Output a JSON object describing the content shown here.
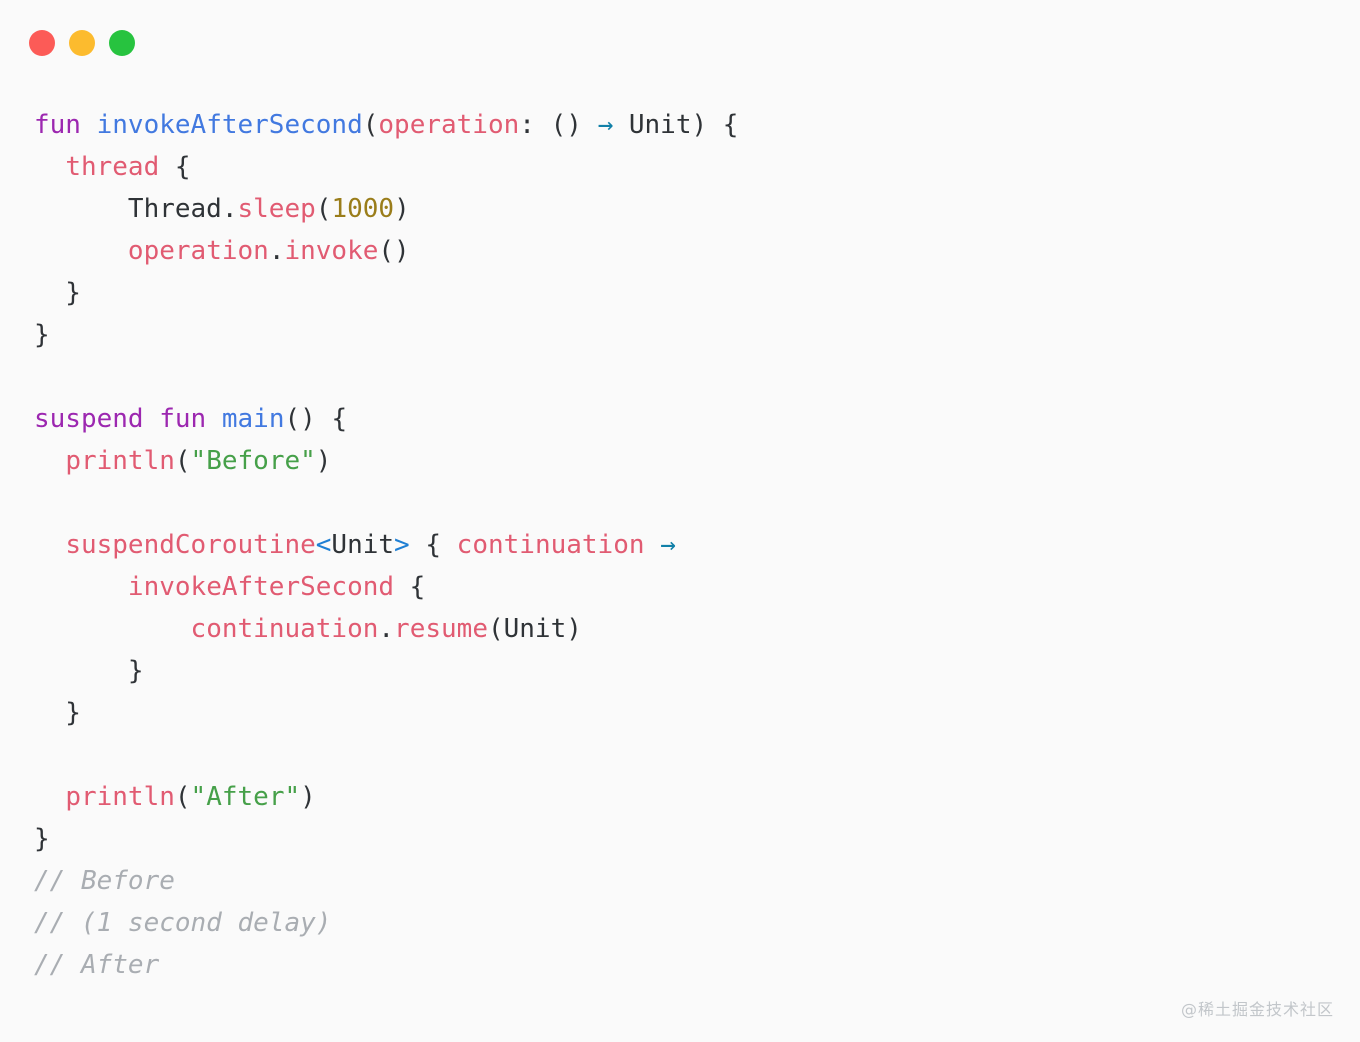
{
  "window": {
    "title": "",
    "controls": [
      {
        "name": "close",
        "color": "#fc5b57"
      },
      {
        "name": "minimize",
        "color": "#fcbb2e"
      },
      {
        "name": "maximize",
        "color": "#27c33f"
      }
    ]
  },
  "theme": {
    "background": "#fafafa",
    "foreground": "#2f3337",
    "keyword": "#9c27b0",
    "function_declaration": "#4279e0",
    "function_call": "#e15b72",
    "identifier": "#e15b72",
    "number": "#9a7d1a",
    "string": "#46a049",
    "arrow": "#1180a8",
    "angle_bracket": "#1e7fd4",
    "comment": "#a9adb2"
  },
  "code": {
    "language": "Kotlin",
    "lines": [
      {
        "n": 1,
        "tokens": [
          {
            "t": "fun",
            "c": "kw"
          },
          {
            "t": " ",
            "c": "plain"
          },
          {
            "t": "invokeAfterSecond",
            "c": "fn-decl"
          },
          {
            "t": "(",
            "c": "plain"
          },
          {
            "t": "operation",
            "c": "ident"
          },
          {
            "t": ": () ",
            "c": "plain"
          },
          {
            "t": "→",
            "c": "arrow"
          },
          {
            "t": " Unit) {",
            "c": "plain"
          }
        ]
      },
      {
        "n": 2,
        "tokens": [
          {
            "t": "  ",
            "c": "plain"
          },
          {
            "t": "thread",
            "c": "fn"
          },
          {
            "t": " {",
            "c": "plain"
          }
        ]
      },
      {
        "n": 3,
        "tokens": [
          {
            "t": "      Thread.",
            "c": "plain"
          },
          {
            "t": "sleep",
            "c": "fn"
          },
          {
            "t": "(",
            "c": "plain"
          },
          {
            "t": "1000",
            "c": "num"
          },
          {
            "t": ")",
            "c": "plain"
          }
        ]
      },
      {
        "n": 4,
        "tokens": [
          {
            "t": "      ",
            "c": "plain"
          },
          {
            "t": "operation",
            "c": "ident"
          },
          {
            "t": ".",
            "c": "plain"
          },
          {
            "t": "invoke",
            "c": "fn"
          },
          {
            "t": "()",
            "c": "plain"
          }
        ]
      },
      {
        "n": 5,
        "tokens": [
          {
            "t": "  }",
            "c": "plain"
          }
        ]
      },
      {
        "n": 6,
        "tokens": [
          {
            "t": "}",
            "c": "plain"
          }
        ]
      },
      {
        "n": 7,
        "tokens": []
      },
      {
        "n": 8,
        "tokens": [
          {
            "t": "suspend",
            "c": "kw"
          },
          {
            "t": " ",
            "c": "plain"
          },
          {
            "t": "fun",
            "c": "kw"
          },
          {
            "t": " ",
            "c": "plain"
          },
          {
            "t": "main",
            "c": "fn-decl"
          },
          {
            "t": "() {",
            "c": "plain"
          }
        ]
      },
      {
        "n": 9,
        "tokens": [
          {
            "t": "  ",
            "c": "plain"
          },
          {
            "t": "println",
            "c": "fn"
          },
          {
            "t": "(",
            "c": "plain"
          },
          {
            "t": "\"Before\"",
            "c": "str"
          },
          {
            "t": ")",
            "c": "plain"
          }
        ]
      },
      {
        "n": 10,
        "tokens": []
      },
      {
        "n": 11,
        "tokens": [
          {
            "t": "  ",
            "c": "plain"
          },
          {
            "t": "suspendCoroutine",
            "c": "fn"
          },
          {
            "t": "<",
            "c": "angle"
          },
          {
            "t": "Unit",
            "c": "type"
          },
          {
            "t": ">",
            "c": "angle"
          },
          {
            "t": " { ",
            "c": "plain"
          },
          {
            "t": "continuation",
            "c": "ident"
          },
          {
            "t": " ",
            "c": "plain"
          },
          {
            "t": "→",
            "c": "arrow"
          }
        ]
      },
      {
        "n": 12,
        "tokens": [
          {
            "t": "      ",
            "c": "plain"
          },
          {
            "t": "invokeAfterSecond",
            "c": "fn"
          },
          {
            "t": " {",
            "c": "plain"
          }
        ]
      },
      {
        "n": 13,
        "tokens": [
          {
            "t": "          ",
            "c": "plain"
          },
          {
            "t": "continuation",
            "c": "ident"
          },
          {
            "t": ".",
            "c": "plain"
          },
          {
            "t": "resume",
            "c": "fn"
          },
          {
            "t": "(Unit)",
            "c": "plain"
          }
        ]
      },
      {
        "n": 14,
        "tokens": [
          {
            "t": "      }",
            "c": "plain"
          }
        ]
      },
      {
        "n": 15,
        "tokens": [
          {
            "t": "  }",
            "c": "plain"
          }
        ]
      },
      {
        "n": 16,
        "tokens": []
      },
      {
        "n": 17,
        "tokens": [
          {
            "t": "  ",
            "c": "plain"
          },
          {
            "t": "println",
            "c": "fn"
          },
          {
            "t": "(",
            "c": "plain"
          },
          {
            "t": "\"After\"",
            "c": "str"
          },
          {
            "t": ")",
            "c": "plain"
          }
        ]
      },
      {
        "n": 18,
        "tokens": [
          {
            "t": "}",
            "c": "plain"
          }
        ]
      },
      {
        "n": 19,
        "tokens": [
          {
            "t": "// Before",
            "c": "cmt"
          }
        ]
      },
      {
        "n": 20,
        "tokens": [
          {
            "t": "// (1 second delay)",
            "c": "cmt"
          }
        ]
      },
      {
        "n": 21,
        "tokens": [
          {
            "t": "// After",
            "c": "cmt"
          }
        ]
      }
    ]
  },
  "watermark": {
    "text": "@稀土掘金技术社区"
  }
}
